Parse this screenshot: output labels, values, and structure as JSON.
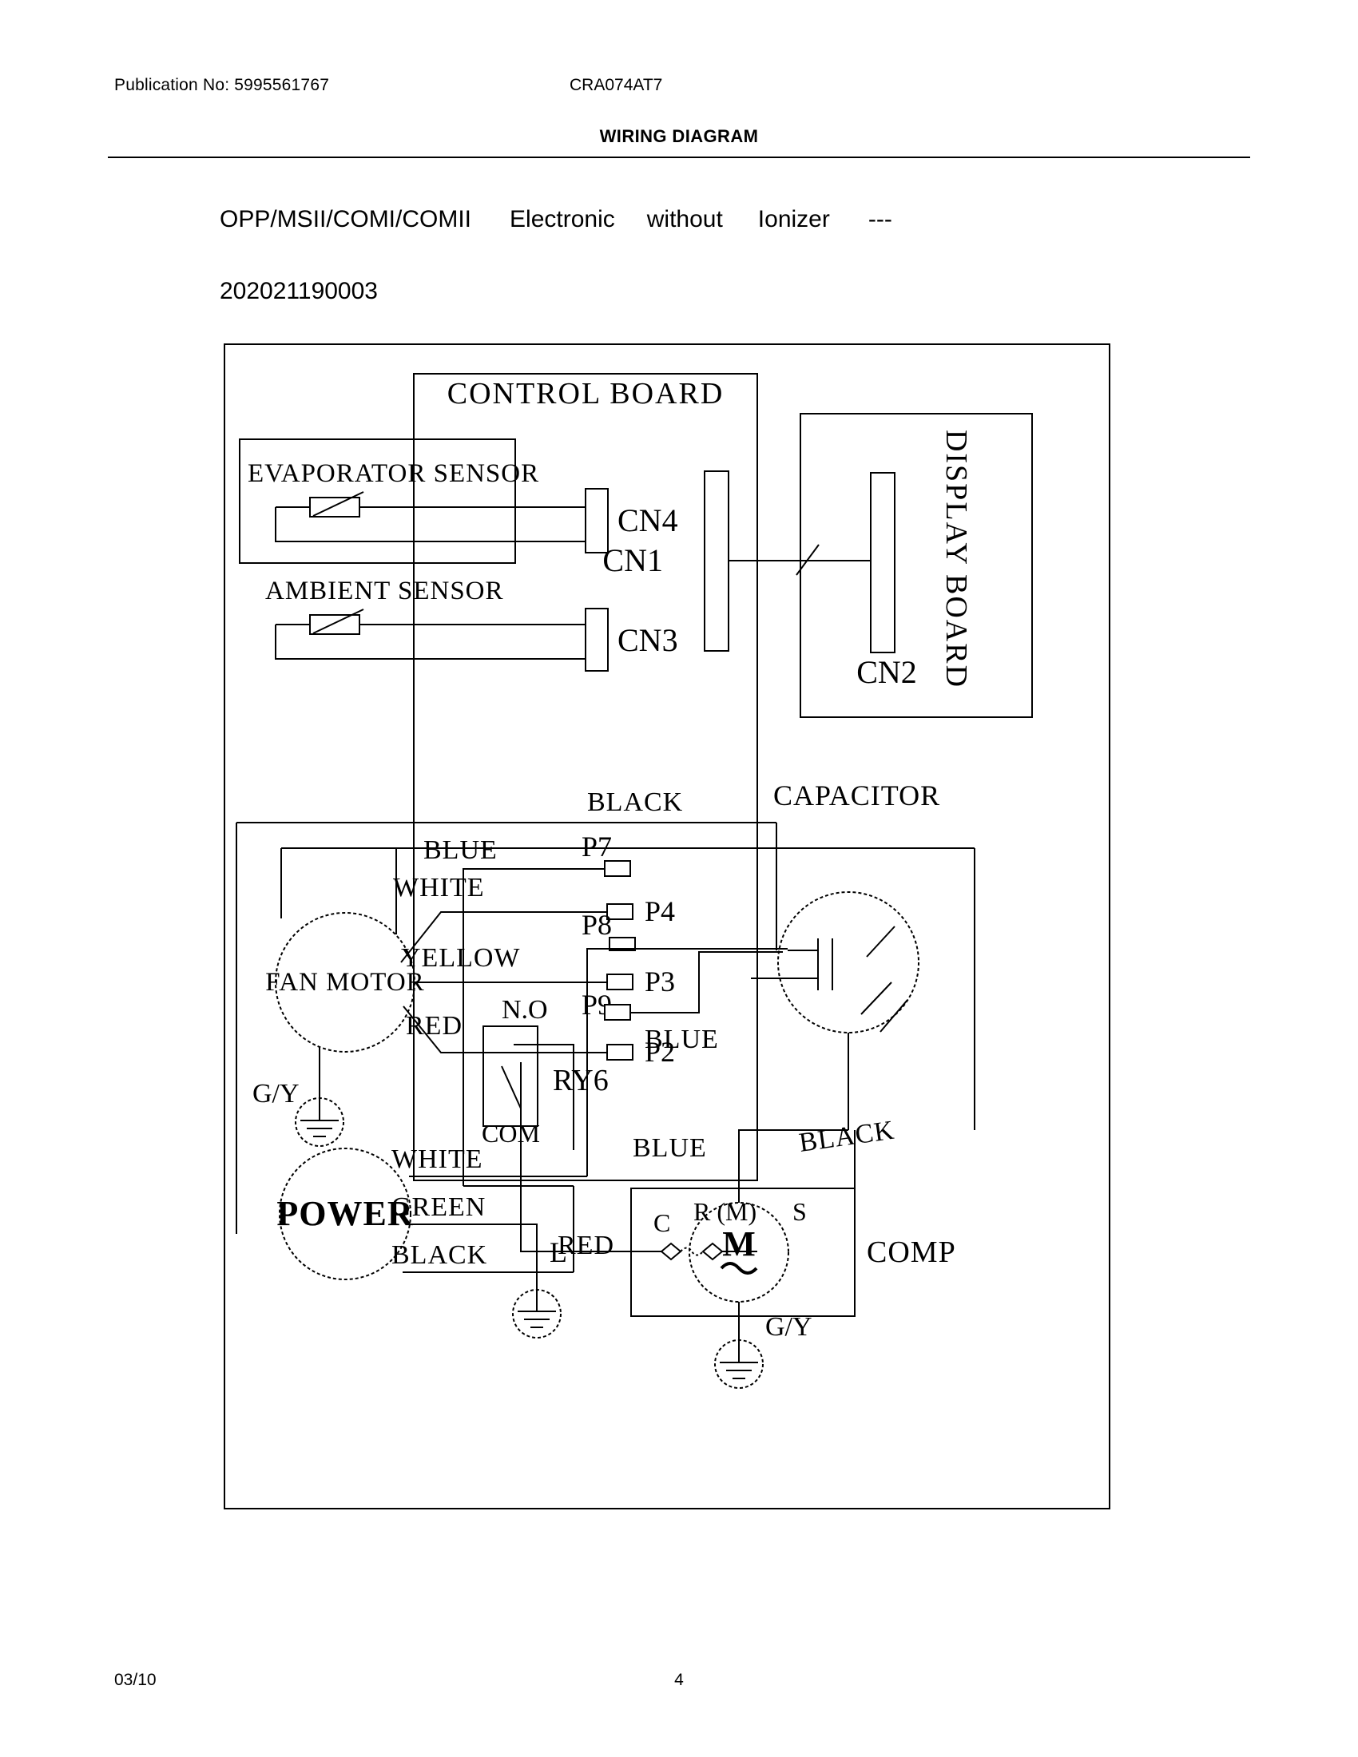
{
  "header": {
    "publication_label": "Publication No: 5995561767",
    "model": "CRA074AT7",
    "title": "WIRING DIAGRAM"
  },
  "description": {
    "variants": "OPP/MSII/COMI/COMII",
    "control_type": "Electronic",
    "preposition": "without",
    "feature": "Ionizer",
    "dash": "---",
    "code": "202021190003"
  },
  "diagram": {
    "control_board": {
      "label": "CONTROL BOARD",
      "connectors": {
        "cn1": "CN1",
        "cn3": "CN3",
        "cn4": "CN4"
      }
    },
    "display_board": {
      "label": "DISPLAY BOARD",
      "connector": "CN2"
    },
    "sensors": {
      "evaporator": "EVAPORATOR SENSOR",
      "ambient": "AMBIENT SENSOR"
    },
    "fan_motor": {
      "label": "FAN MOTOR",
      "ground": "G/Y",
      "wires": [
        {
          "color": "BLUE",
          "terminal": ""
        },
        {
          "color": "WHITE",
          "terminal": "P4"
        },
        {
          "color": "YELLOW",
          "terminal": "P3"
        },
        {
          "color": "RED",
          "terminal": "P2"
        }
      ]
    },
    "relay": {
      "label": "RY6",
      "normally_open": "N.O",
      "common": "COM"
    },
    "terminals": {
      "p7": "P7",
      "p8": "P8",
      "p9": "P9"
    },
    "capacitor": {
      "label": "CAPACITOR"
    },
    "power": {
      "label": "POWER",
      "wires": [
        "WHITE",
        "GREEN",
        "BLACK"
      ],
      "line_label": "L"
    },
    "compressor": {
      "label": "COMP",
      "motor_symbol": "M",
      "terminals": {
        "c": "C",
        "r": "R (M)",
        "s": "S"
      },
      "ground": "G/Y"
    },
    "wire_labels": {
      "black_top": "BLACK",
      "blue_p9": "BLUE",
      "blue_comp": "BLUE",
      "black_comp": "BLACK",
      "red_comp": "RED"
    }
  },
  "footer": {
    "date": "03/10",
    "page_number": "4"
  },
  "colors": {
    "ink": "#000000",
    "paper": "#ffffff"
  }
}
